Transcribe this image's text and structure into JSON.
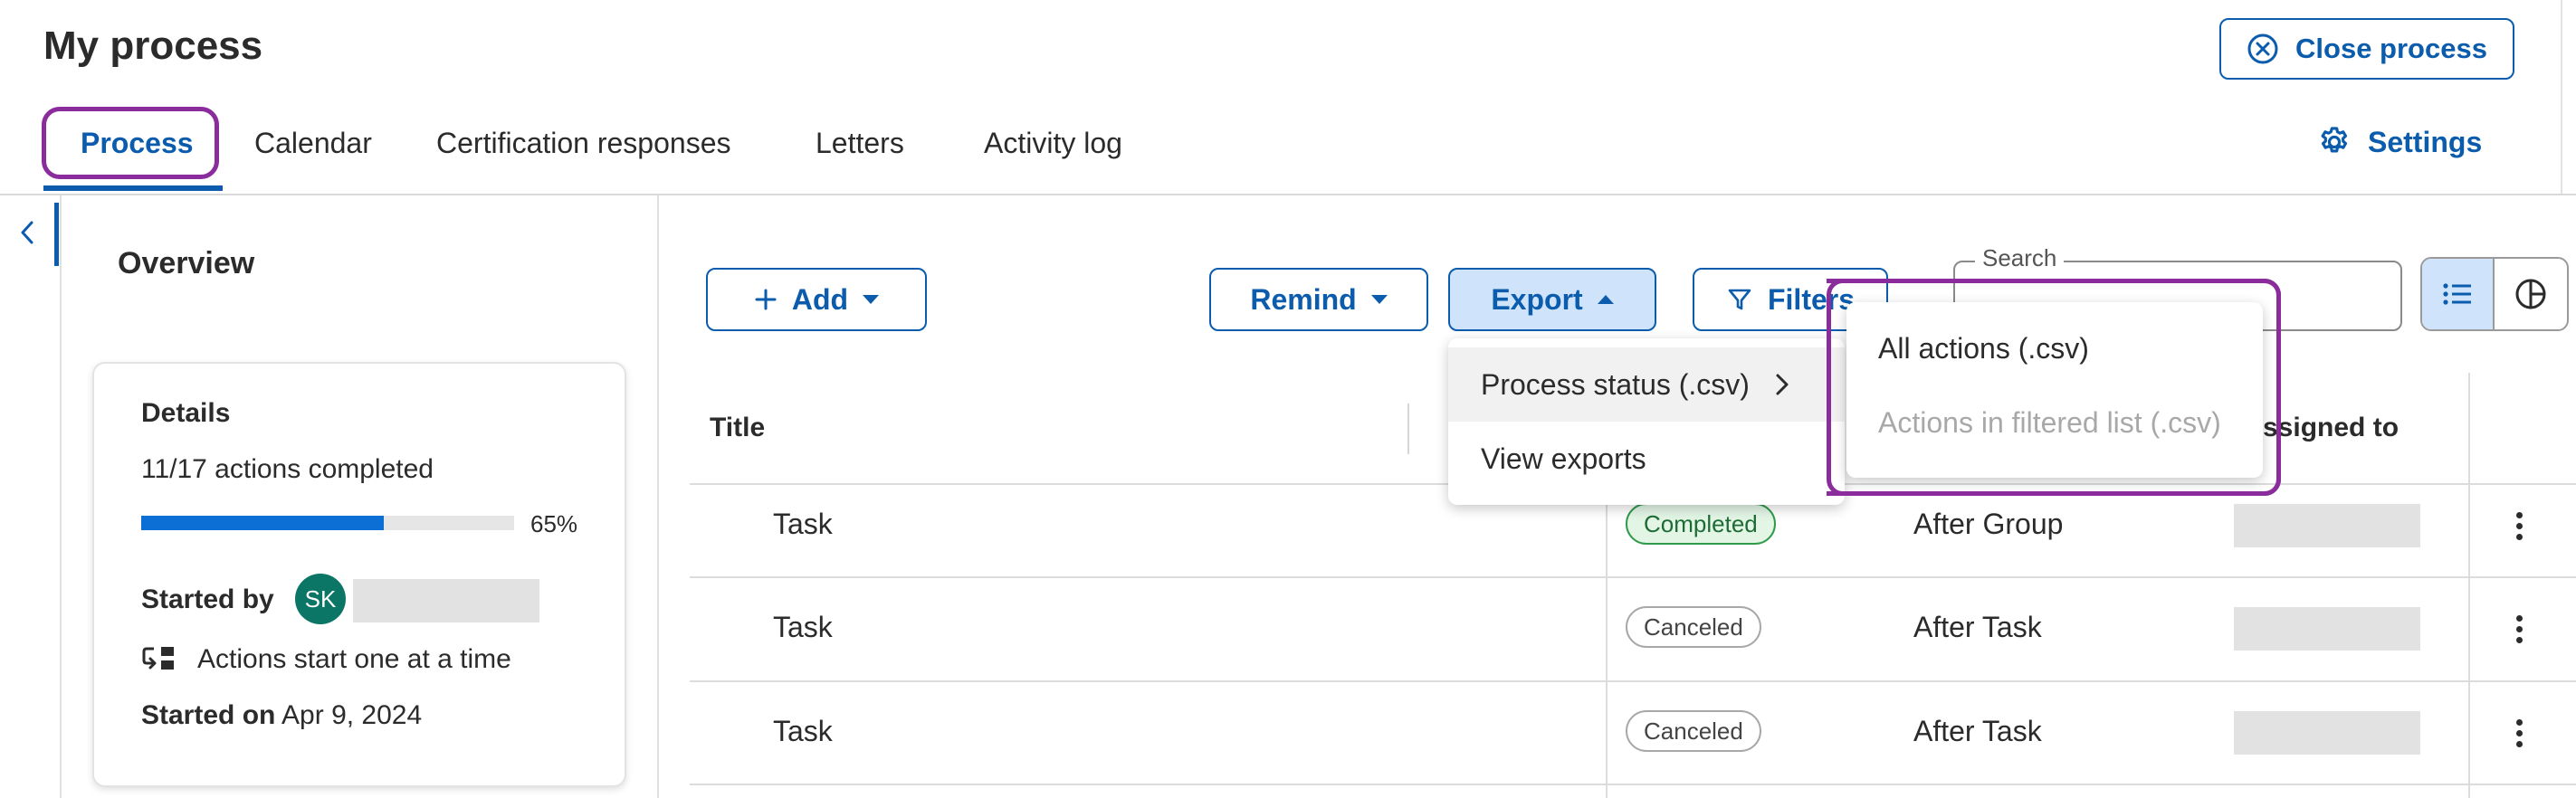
{
  "header": {
    "title": "My process",
    "close_button": "Close process",
    "settings": "Settings"
  },
  "tabs": [
    {
      "label": "Process",
      "active": true
    },
    {
      "label": "Calendar"
    },
    {
      "label": "Certification responses"
    },
    {
      "label": "Letters"
    },
    {
      "label": "Activity log"
    }
  ],
  "overview": {
    "title": "Overview",
    "details_title": "Details",
    "actions_completed": "11/17 actions completed",
    "progress_percent_label": "65%",
    "progress_fraction": 0.65,
    "started_by_label": "Started by",
    "avatar_initials": "SK",
    "mode_text": "Actions start one at a time",
    "started_on_label": "Started on",
    "started_on_value": "Apr 9, 2024"
  },
  "toolbar": {
    "add": "Add",
    "remind": "Remind",
    "export": "Export",
    "filters": "Filters",
    "search_label": "Search"
  },
  "export_menu": {
    "items": [
      "Process status (.csv)",
      "View exports"
    ]
  },
  "submenu": {
    "items": [
      "All actions (.csv)",
      "Actions in filtered list (.csv)"
    ]
  },
  "table": {
    "headers": {
      "title": "Title",
      "assigned_to": "ssigned to"
    },
    "rows": [
      {
        "title": "Task",
        "status": "Completed",
        "start": "After Group"
      },
      {
        "title": "Task",
        "status": "Canceled",
        "start": "After Task"
      },
      {
        "title": "Task",
        "status": "Canceled",
        "start": "After Task"
      }
    ]
  },
  "colors": {
    "primary": "#0b5cad",
    "highlight": "#8a2c9b",
    "progress": "#0b6fd6",
    "avatar": "#0b7566"
  }
}
